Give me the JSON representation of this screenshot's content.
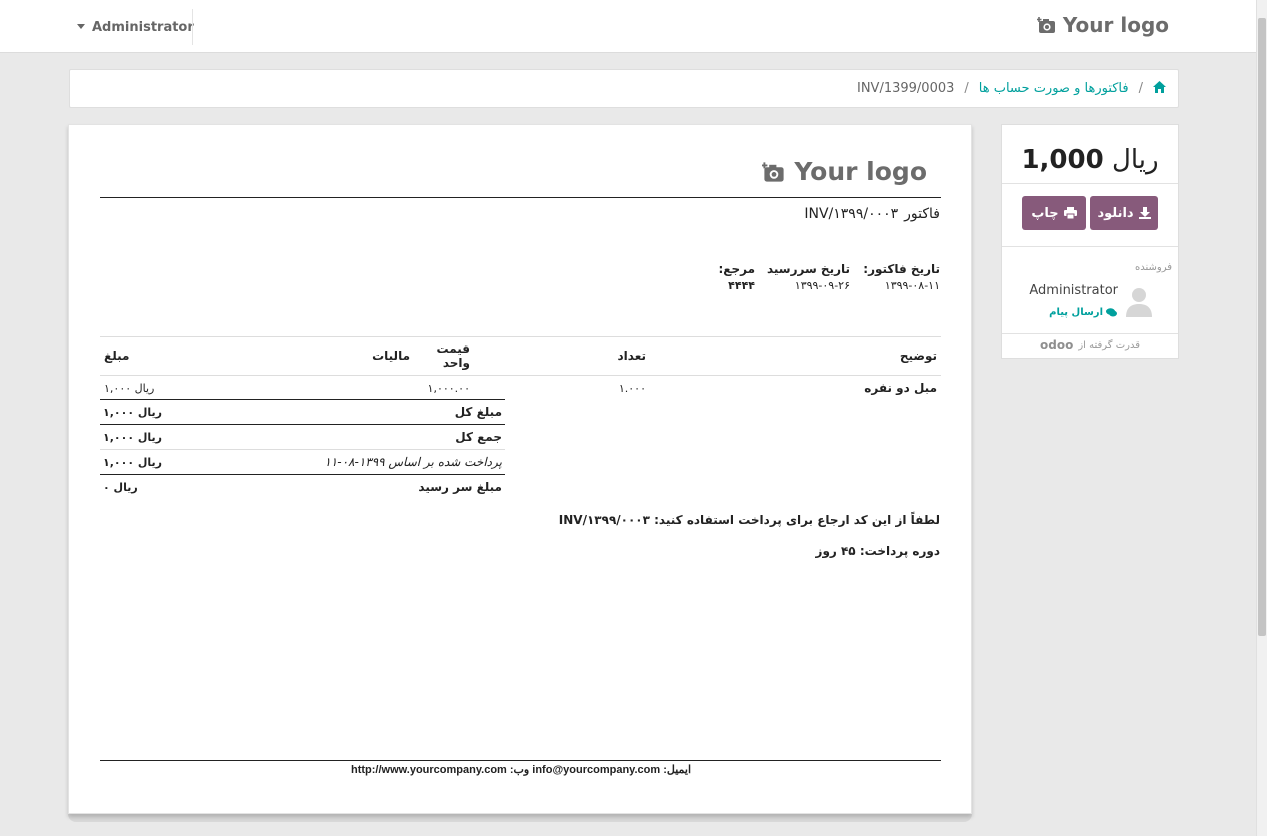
{
  "topbar": {
    "user_name": "Administrator",
    "brand": "Your logo"
  },
  "breadcrumb": {
    "home_icon": "home-icon",
    "invoices_link": "فاکتورها و صورت حساب ها",
    "separator": "/",
    "current": "INV/1399/0003"
  },
  "invoice": {
    "logo": "Your logo",
    "title_label": "فاکتور",
    "title_number": "INV/۱۳۹۹/۰۰۰۳",
    "info": [
      {
        "label": "تاریخ فاکتور:",
        "value": "۱۳۹۹-۰۸-۱۱"
      },
      {
        "label": "تاریخ سررسید",
        "value": "۱۳۹۹-۰۹-۲۶"
      },
      {
        "label": "مرجع:",
        "value": "۴۴۴۴"
      }
    ],
    "columns": {
      "description": "توضیح",
      "quantity": "تعداد",
      "unit_price": "قیمت واحد",
      "taxes": "مالیات",
      "amount": "مبلغ"
    },
    "lines": [
      {
        "description": "مبل دو نفره",
        "quantity": "۱.۰۰۰",
        "unit_price": "۱,۰۰۰.۰۰",
        "taxes": "",
        "amount": "۱,۰۰۰ ریال"
      }
    ],
    "totals": [
      {
        "label": "مبلغ کل",
        "amount": "۱,۰۰۰ ریال"
      },
      {
        "label": "جمع کل",
        "amount": "۱,۰۰۰ ریال"
      },
      {
        "label": "پرداخت شده بر اساس ۱۳۹۹-۰۸-۱۱",
        "amount": "۱,۰۰۰ ریال"
      },
      {
        "label": "مبلغ سر رسید",
        "amount": "۰ ریال"
      }
    ],
    "payment_ref_note": "لطفاً از این کد ارجاع برای پرداخت استفاده کنید: INV/۱۳۹۹/۰۰۰۳",
    "payment_terms_note": "دوره پرداخت: ۴۵ روز",
    "footer": "ایمیل: info@yourcompany.com   وب: http://www.yourcompany.com"
  },
  "side": {
    "amount_value": "1,000",
    "amount_currency": "ریال",
    "download_label": "دانلود",
    "print_label": "چاپ",
    "seller_label": "فروشنده",
    "seller_name": "Administrator",
    "send_message": "ارسال پیام",
    "powered_by": "قدرت گرفته از",
    "powered_brand": "odoo"
  },
  "colors": {
    "accent": "#875a7b",
    "link": "#00a09d"
  }
}
